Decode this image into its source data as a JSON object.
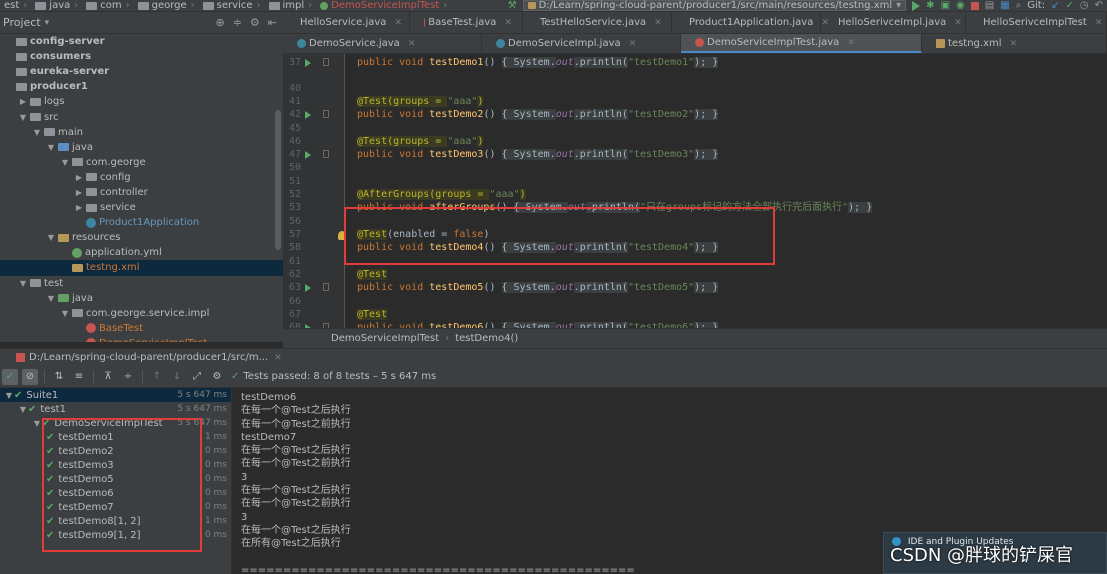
{
  "topbar": {
    "crumbs": [
      "est",
      "java",
      "com",
      "george",
      "service",
      "impl",
      "DemoServiceImplTest"
    ],
    "run_config": "D:/Learn/spring-cloud-parent/producer1/src/main/resources/testng.xml",
    "git_label": "Git:"
  },
  "project": {
    "title": "Project",
    "tree": [
      {
        "label": "config-server",
        "indent": 0,
        "bold": true,
        "icon": "folder",
        "arrow": ""
      },
      {
        "label": "consumers",
        "indent": 0,
        "bold": true,
        "icon": "folder",
        "arrow": ""
      },
      {
        "label": "eureka-server",
        "indent": 0,
        "bold": true,
        "icon": "folder",
        "arrow": ""
      },
      {
        "label": "producer1",
        "indent": 0,
        "bold": true,
        "icon": "folder",
        "arrow": ""
      },
      {
        "label": "logs",
        "indent": 1,
        "bold": false,
        "icon": "folder",
        "arrow": "▶"
      },
      {
        "label": "src",
        "indent": 1,
        "bold": false,
        "icon": "folder",
        "arrow": "▼"
      },
      {
        "label": "main",
        "indent": 2,
        "bold": false,
        "icon": "folder",
        "arrow": "▼"
      },
      {
        "label": "java",
        "indent": 3,
        "bold": false,
        "icon": "folder-blue",
        "arrow": "▼"
      },
      {
        "label": "com.george",
        "indent": 4,
        "bold": false,
        "icon": "folder",
        "arrow": "▼"
      },
      {
        "label": "config",
        "indent": 5,
        "bold": false,
        "icon": "folder",
        "arrow": "▶"
      },
      {
        "label": "controller",
        "indent": 5,
        "bold": false,
        "icon": "folder",
        "arrow": "▶"
      },
      {
        "label": "service",
        "indent": 5,
        "bold": false,
        "icon": "folder",
        "arrow": "▶"
      },
      {
        "label": "Product1Application",
        "indent": 5,
        "bold": false,
        "icon": "class",
        "arrow": "",
        "color": "blue"
      },
      {
        "label": "resources",
        "indent": 3,
        "bold": false,
        "icon": "folder-orange",
        "arrow": "▼"
      },
      {
        "label": "application.yml",
        "indent": 4,
        "bold": false,
        "icon": "yml",
        "arrow": ""
      },
      {
        "label": "testng.xml",
        "indent": 4,
        "bold": false,
        "icon": "xml",
        "arrow": "",
        "color": "red",
        "selected": true
      },
      {
        "label": "test",
        "indent": 1,
        "bold": false,
        "icon": "folder",
        "arrow": "▼"
      },
      {
        "label": "java",
        "indent": 3,
        "bold": false,
        "icon": "folder-green",
        "arrow": "▼"
      },
      {
        "label": "com.george.service.impl",
        "indent": 4,
        "bold": false,
        "icon": "folder",
        "arrow": "▼"
      },
      {
        "label": "BaseTest",
        "indent": 5,
        "bold": false,
        "icon": "class-red",
        "arrow": "",
        "color": "red"
      },
      {
        "label": "DemoServiceImplTest",
        "indent": 5,
        "bold": false,
        "icon": "class-red",
        "arrow": "",
        "color": "red"
      }
    ]
  },
  "editor": {
    "tabs_row1": [
      "HelloService.java",
      "BaseTest.java",
      "TestHelloService.java",
      "Product1Application.java",
      "HelloSerivceImpl.java",
      "HelloSerivceImplTest"
    ],
    "tabs_row2": [
      "DemoService.java",
      "DemoServiceImpl.java",
      "DemoServiceImplTest.java",
      "testng.xml"
    ],
    "active_tab": "DemoServiceImplTest.java",
    "lines": [
      {
        "n": "37",
        "run": true,
        "parts": [
          [
            "kw",
            "public void "
          ],
          [
            "fn",
            "testDemo1"
          ],
          [
            "",
            "() "
          ],
          [
            "fold",
            "{ System."
          ],
          [
            "it",
            "out"
          ],
          [
            "fold",
            ".println("
          ],
          [
            "str",
            "\"testDemo1\""
          ],
          [
            "fold",
            "); }"
          ]
        ]
      },
      {
        "n": "40",
        "run": false,
        "parts": []
      },
      {
        "n": "41",
        "run": false,
        "parts": [
          [
            "ann",
            "@Test"
          ],
          [
            "ann",
            "(groups = "
          ],
          [
            "str",
            "\"aaa\""
          ],
          [
            "ann",
            ")"
          ]
        ]
      },
      {
        "n": "42",
        "run": true,
        "parts": [
          [
            "kw",
            "public void "
          ],
          [
            "fn",
            "testDemo2"
          ],
          [
            "",
            "() "
          ],
          [
            "fold",
            "{ System."
          ],
          [
            "it",
            "out"
          ],
          [
            "fold",
            ".println("
          ],
          [
            "str",
            "\"testDemo2\""
          ],
          [
            "fold",
            "); }"
          ]
        ]
      },
      {
        "n": "45",
        "run": false,
        "parts": []
      },
      {
        "n": "46",
        "run": false,
        "parts": [
          [
            "ann",
            "@Test"
          ],
          [
            "ann",
            "(groups = "
          ],
          [
            "str",
            "\"aaa\""
          ],
          [
            "ann",
            ")"
          ]
        ]
      },
      {
        "n": "47",
        "run": true,
        "parts": [
          [
            "kw",
            "public void "
          ],
          [
            "fn",
            "testDemo3"
          ],
          [
            "",
            "() "
          ],
          [
            "fold",
            "{ System."
          ],
          [
            "it",
            "out"
          ],
          [
            "fold",
            ".println("
          ],
          [
            "str",
            "\"testDemo3\""
          ],
          [
            "fold",
            "); }"
          ]
        ]
      },
      {
        "n": "50",
        "run": false,
        "parts": []
      },
      {
        "n": "51",
        "run": false,
        "parts": []
      },
      {
        "n": "52",
        "run": false,
        "parts": [
          [
            "ann",
            "@AfterGroups"
          ],
          [
            "ann",
            "(groups = "
          ],
          [
            "str",
            "\"aaa\""
          ],
          [
            "ann",
            ")"
          ]
        ]
      },
      {
        "n": "53",
        "run": false,
        "parts": [
          [
            "kw",
            "public void "
          ],
          [
            "fn",
            "afterGroups"
          ],
          [
            "",
            "() "
          ],
          [
            "fold",
            "{ System."
          ],
          [
            "it",
            "out"
          ],
          [
            "fold",
            ".println("
          ],
          [
            "str",
            "\"只在groups标记的方法全部执行完后面执行\""
          ],
          [
            "fold",
            "); }"
          ]
        ]
      },
      {
        "n": "56",
        "run": false,
        "parts": []
      },
      {
        "n": "57",
        "run": false,
        "bulb": true,
        "parts": [
          [
            "ann",
            "@Test"
          ],
          [
            "",
            "(enabled = "
          ],
          [
            "kw",
            "false"
          ],
          [
            "",
            ")"
          ]
        ]
      },
      {
        "n": "58",
        "run": false,
        "parts": [
          [
            "kw",
            "public void "
          ],
          [
            "fn",
            "testDemo4"
          ],
          [
            "",
            "() "
          ],
          [
            "fold",
            "{ System."
          ],
          [
            "it",
            "out"
          ],
          [
            "fold",
            ".println("
          ],
          [
            "str",
            "\"testDemo4\""
          ],
          [
            "fold",
            "); }"
          ]
        ]
      },
      {
        "n": "61",
        "run": false,
        "parts": []
      },
      {
        "n": "62",
        "run": false,
        "parts": [
          [
            "ann",
            "@Test"
          ]
        ]
      },
      {
        "n": "63",
        "run": true,
        "parts": [
          [
            "kw",
            "public void "
          ],
          [
            "fn",
            "testDemo5"
          ],
          [
            "",
            "() "
          ],
          [
            "fold",
            "{ System."
          ],
          [
            "it",
            "out"
          ],
          [
            "fold",
            ".println("
          ],
          [
            "str",
            "\"testDemo5\""
          ],
          [
            "fold",
            "); }"
          ]
        ]
      },
      {
        "n": "66",
        "run": false,
        "parts": []
      },
      {
        "n": "67",
        "run": false,
        "parts": [
          [
            "ann",
            "@Test"
          ]
        ]
      },
      {
        "n": "68",
        "run": true,
        "parts": [
          [
            "kw",
            "public void "
          ],
          [
            "fn",
            "testDemo6"
          ],
          [
            "",
            "() "
          ],
          [
            "fold",
            "{ System."
          ],
          [
            "it",
            "out"
          ],
          [
            "fold",
            ".println("
          ],
          [
            "str",
            "\"testDemo6\""
          ],
          [
            "fold",
            "); }"
          ]
        ]
      }
    ],
    "breadcrumbs": [
      "DemoServiceImplTest",
      "testDemo4()"
    ]
  },
  "run": {
    "header_path": "D:/Learn/spring-cloud-parent/producer1/src/m...",
    "status": "Tests passed: 8 of 8 tests – 5 s 647 ms",
    "tree": [
      {
        "label": "Suite1",
        "time": "5 s 647 ms",
        "indent": 0,
        "arrow": "▼",
        "selected": true
      },
      {
        "label": "test1",
        "time": "5 s 647 ms",
        "indent": 1,
        "arrow": "▼"
      },
      {
        "label": "DemoServiceImplTest",
        "time": "5 s 647 ms",
        "indent": 2,
        "arrow": "▼"
      },
      {
        "label": "testDemo1",
        "time": "1 ms",
        "indent": 3,
        "arrow": ""
      },
      {
        "label": "testDemo2",
        "time": "0 ms",
        "indent": 3,
        "arrow": ""
      },
      {
        "label": "testDemo3",
        "time": "0 ms",
        "indent": 3,
        "arrow": ""
      },
      {
        "label": "testDemo5",
        "time": "0 ms",
        "indent": 3,
        "arrow": ""
      },
      {
        "label": "testDemo6",
        "time": "0 ms",
        "indent": 3,
        "arrow": ""
      },
      {
        "label": "testDemo7",
        "time": "0 ms",
        "indent": 3,
        "arrow": ""
      },
      {
        "label": "testDemo8[1, 2]",
        "time": "1 ms",
        "indent": 3,
        "arrow": ""
      },
      {
        "label": "testDemo9[1, 2]",
        "time": "0 ms",
        "indent": 3,
        "arrow": ""
      }
    ],
    "console": [
      "testDemo6",
      "在每一个@Test之后执行",
      "在每一个@Test之前执行",
      "testDemo7",
      "在每一个@Test之后执行",
      "在每一个@Test之前执行",
      "3",
      "在每一个@Test之后执行",
      "在每一个@Test之前执行",
      "3",
      "在每一个@Test之后执行",
      "在所有@Test之后执行",
      "",
      "==============================================="
    ]
  },
  "notification": {
    "title": "IDE and Plugin Updates"
  },
  "watermark": "CSDN @胖球的铲屎官"
}
